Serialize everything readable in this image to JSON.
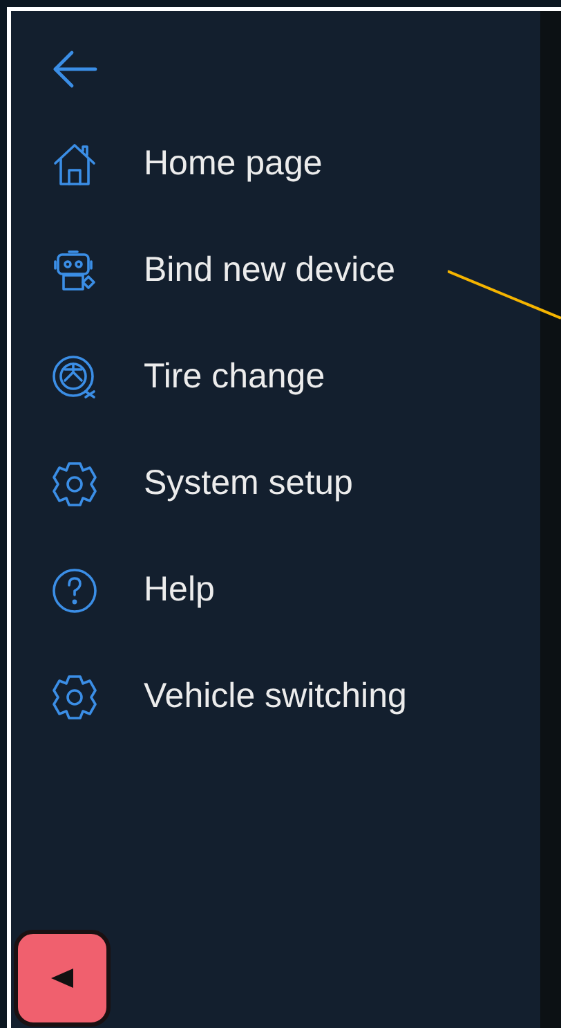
{
  "menu": {
    "items": [
      {
        "label": "Home page"
      },
      {
        "label": "Bind new device"
      },
      {
        "label": "Tire change"
      },
      {
        "label": "System setup"
      },
      {
        "label": "Help"
      },
      {
        "label": "Vehicle switching"
      }
    ]
  }
}
